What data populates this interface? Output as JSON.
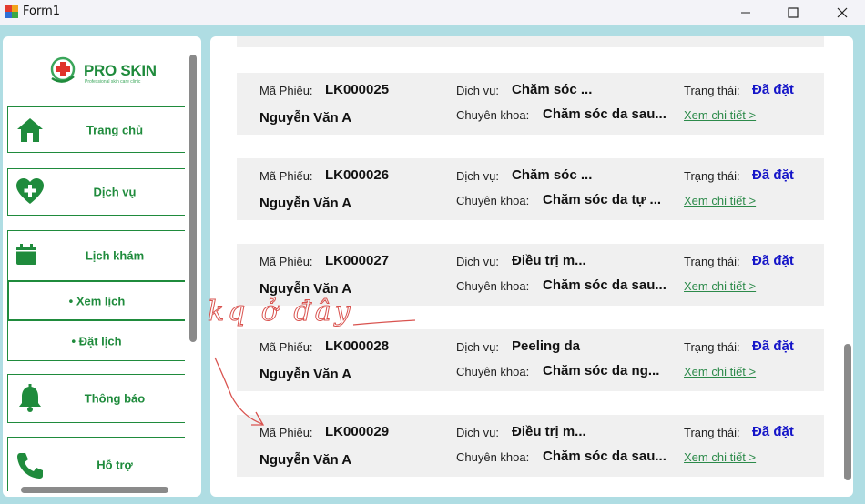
{
  "window": {
    "title": "Form1"
  },
  "sidebar": {
    "logo_text": "PRO SKIN",
    "logo_subtitle": "Professional skin care clinic",
    "items": [
      {
        "label": "Trang chủ",
        "icon": "home-icon"
      },
      {
        "label": "Dịch vụ",
        "icon": "heart-plus-icon"
      },
      {
        "label": "Lịch khám",
        "icon": "calendar-icon"
      },
      {
        "label": "Thông báo",
        "icon": "bell-icon"
      },
      {
        "label": "Hỗ trợ",
        "icon": "phone-icon"
      }
    ],
    "sub_items": [
      {
        "label": "• Xem lịch"
      },
      {
        "label": "• Đặt lịch"
      }
    ]
  },
  "labels": {
    "ma_phieu": "Mã Phiếu:",
    "dich_vu": "Dịch vụ:",
    "chuyen_khoa": "Chuyên khoa:",
    "trang_thai": "Trạng thái:",
    "detail_link": "Xem chi tiết >"
  },
  "bookings": [
    {
      "code": "LK000025",
      "patient": "Nguyễn Văn A",
      "service": "Chăm sóc ...",
      "specialty": "Chăm sóc da sau...",
      "status": "Đã đặt"
    },
    {
      "code": "LK000026",
      "patient": "Nguyễn Văn A",
      "service": "Chăm sóc ...",
      "specialty": "Chăm sóc da tự ...",
      "status": "Đã đặt"
    },
    {
      "code": "LK000027",
      "patient": "Nguyễn Văn A",
      "service": "Điều trị m...",
      "specialty": "Chăm sóc da sau...",
      "status": "Đã đặt"
    },
    {
      "code": "LK000028",
      "patient": "Nguyễn Văn A",
      "service": "Peeling da",
      "specialty": "Chăm sóc da ng...",
      "status": "Đã đặt"
    },
    {
      "code": "LK000029",
      "patient": "Nguyễn Văn A",
      "service": "Điều trị m...",
      "specialty": "Chăm sóc da sau...",
      "status": "Đã đặt"
    }
  ],
  "annotation_text": "kq ở đây",
  "colors": {
    "brand_green": "#1f8b3c",
    "status_blue": "#1515c8",
    "background": "#afdde3",
    "card_bg": "#f0f0f0",
    "annotation_red": "#d9534f"
  }
}
